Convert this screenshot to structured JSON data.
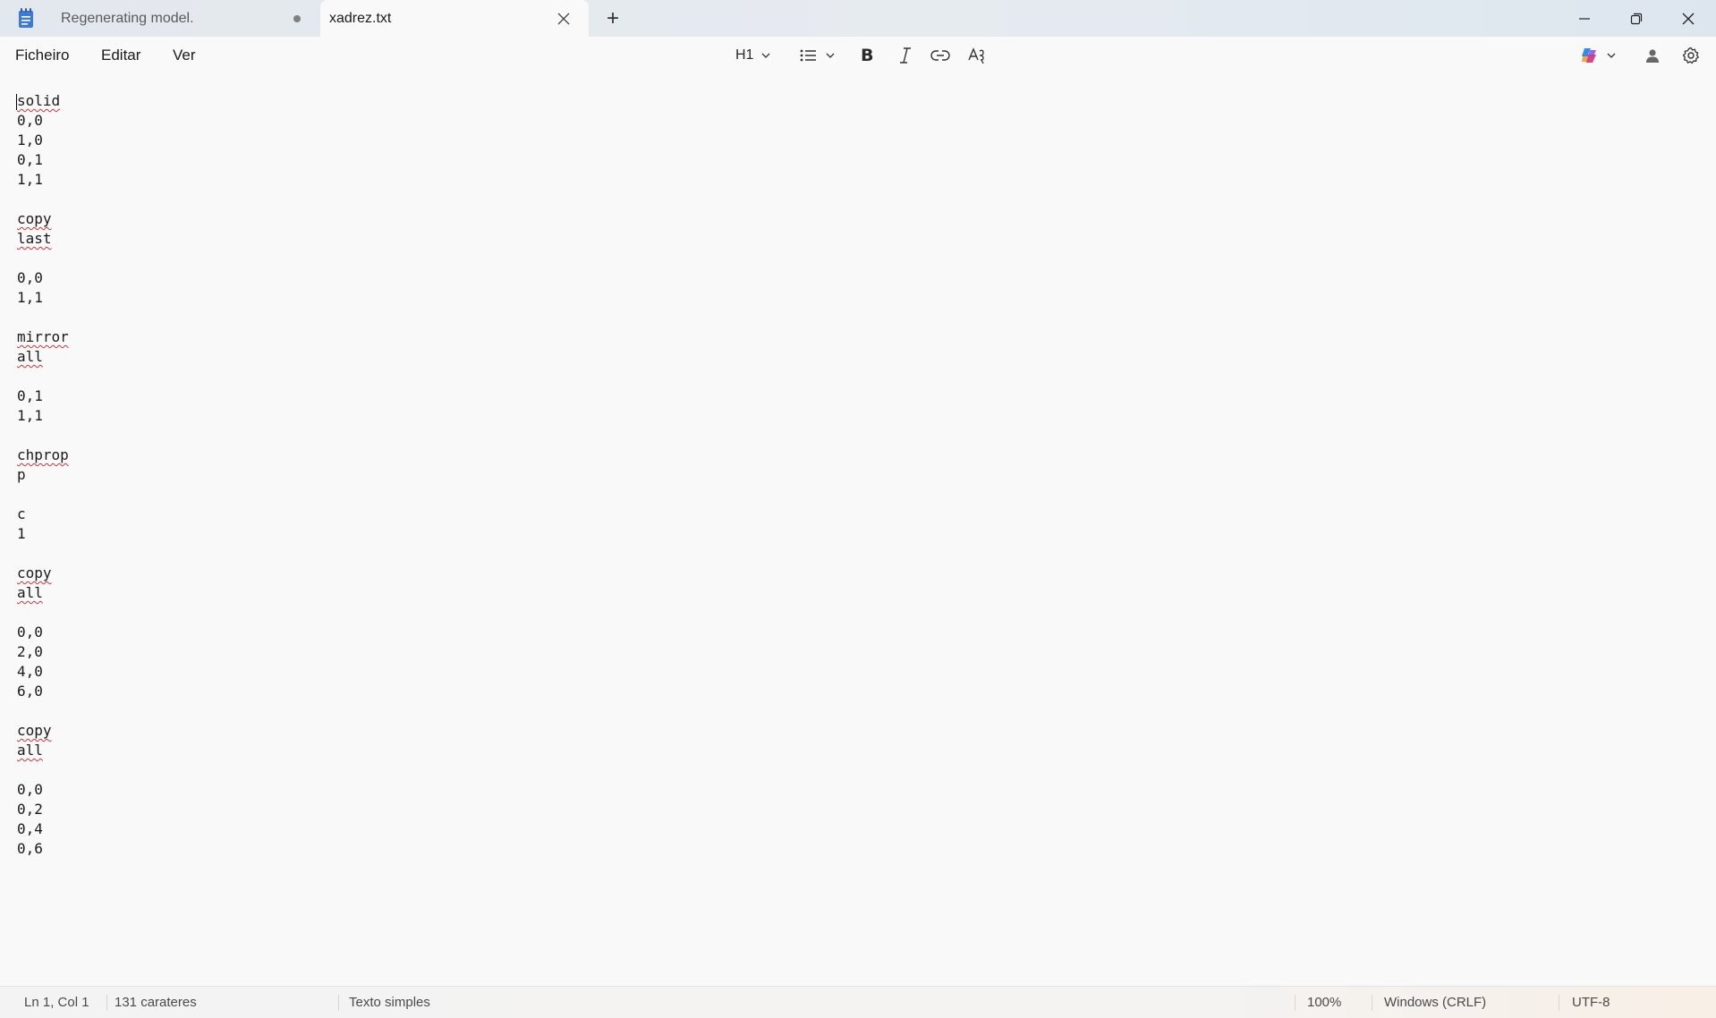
{
  "window": {
    "tabs": [
      {
        "label": "Regenerating model.",
        "unsaved": true
      },
      {
        "label": "xadrez.txt",
        "active": true
      }
    ],
    "new_tab_symbol": "+",
    "controls": [
      "minimize-icon",
      "restore-icon",
      "close-icon"
    ]
  },
  "menu": {
    "file": "Ficheiro",
    "edit": "Editar",
    "view": "Ver"
  },
  "toolbar": {
    "heading": "H1",
    "list_icon": "bulleted-list-icon",
    "bold": "B",
    "italic_icon": "italic-icon",
    "link_icon": "link-icon",
    "clear_format_icon": "clear-formatting-icon",
    "copilot_icon": "copilot-icon",
    "account_icon": "account-icon",
    "settings_icon": "gear-icon"
  },
  "document": {
    "lines": [
      "solid",
      "0,0",
      "1,0",
      "0,1",
      "1,1",
      "",
      "copy",
      "last",
      "",
      "0,0",
      "1,1",
      "",
      "mirror",
      "all",
      "",
      "0,1",
      "1,1",
      "",
      "chprop",
      "p",
      "",
      "c",
      "1",
      "",
      "copy",
      "all",
      "",
      "0,0",
      "2,0",
      "4,0",
      "6,0",
      "",
      "copy",
      "all",
      "",
      "0,0",
      "0,2",
      "0,4",
      "0,6"
    ],
    "misspelled_words": [
      "solid",
      "copy",
      "last",
      "mirror",
      "all",
      "chprop"
    ]
  },
  "status": {
    "position": "Ln 1, Col 1",
    "characters": "131 carateres",
    "format": "Texto simples",
    "zoom": "100%",
    "line_ending": "Windows (CRLF)",
    "encoding": "UTF-8"
  },
  "colors": {
    "spellcheck_underline": "#d13438",
    "titlebar": "#e4e9ef",
    "editor_bg": "#f9f9f9"
  }
}
